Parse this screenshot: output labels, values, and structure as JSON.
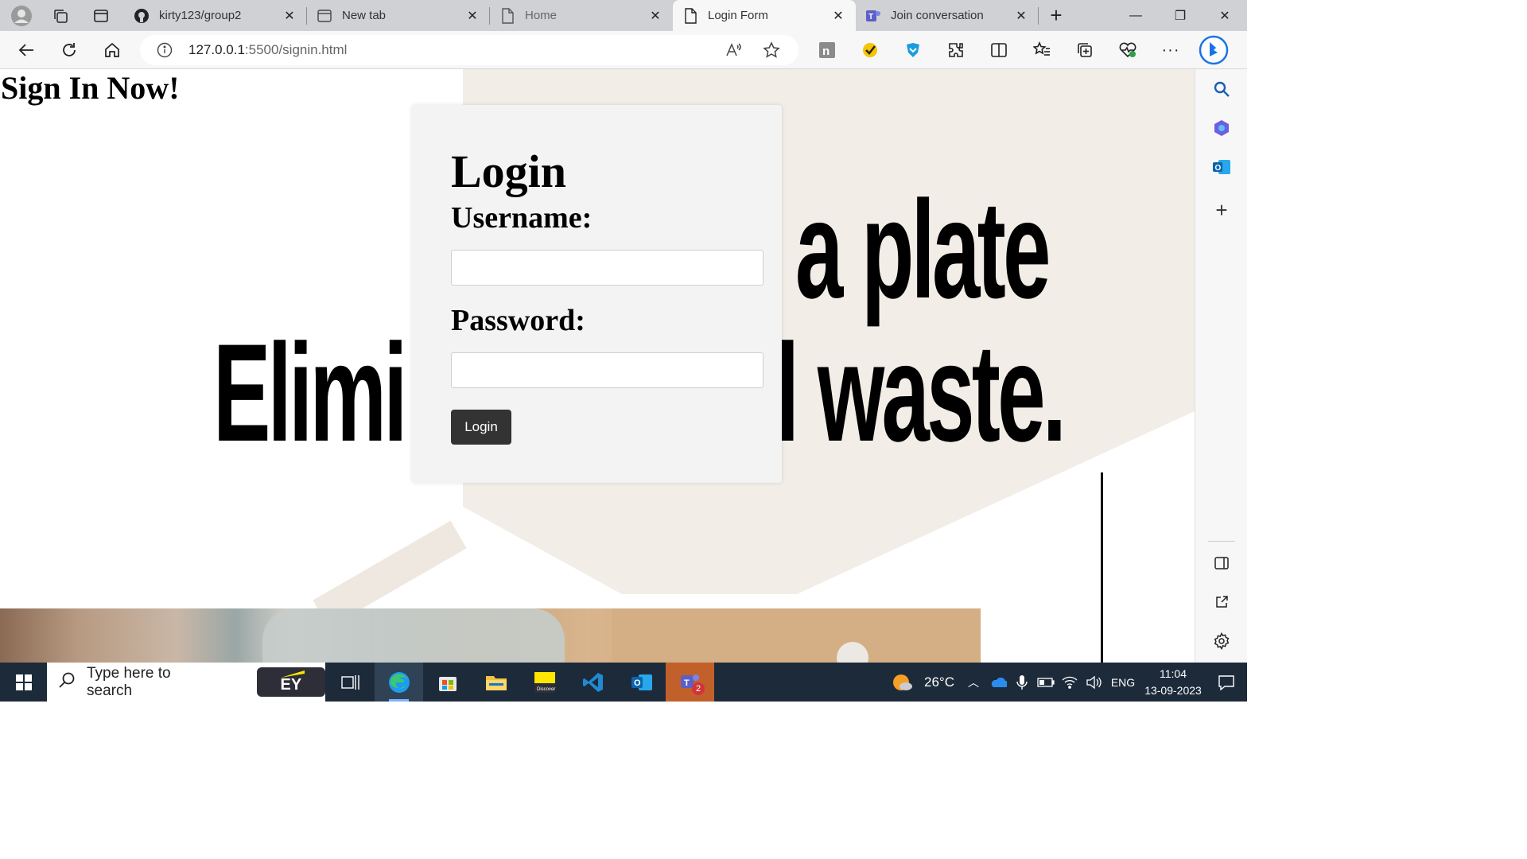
{
  "browser": {
    "tabs": [
      {
        "title": "kirty123/group2",
        "icon": "github-icon",
        "active": false
      },
      {
        "title": "New tab",
        "icon": "newtab-icon",
        "active": false
      },
      {
        "title": "Home",
        "icon": "page-icon",
        "active": false
      },
      {
        "title": "Login Form",
        "icon": "page-icon",
        "active": true
      },
      {
        "title": "Join conversation",
        "icon": "teams-icon",
        "active": false
      }
    ],
    "url_host": "127.0.0.1",
    "url_rest": ":5500/signin.html"
  },
  "page": {
    "heading": "Sign In Now!",
    "hero_line1": "a plate",
    "hero_line2_left": "Elimi",
    "hero_line2_right": "l waste.",
    "form": {
      "title": "Login",
      "username_label": "Username:",
      "username_value": "",
      "password_label": "Password:",
      "password_value": "",
      "submit_label": "Login"
    }
  },
  "taskbar": {
    "search_placeholder": "Type here to search",
    "ey_label": "EY",
    "weather": "26°C",
    "language": "ENG",
    "time": "11:04",
    "date": "13-09-2023",
    "teams_badge": "2"
  },
  "colors": {
    "accent": "#0078d4",
    "card_bg": "#f3f3f3",
    "button_bg": "#333333",
    "taskbar_bg": "#1d2a3a"
  }
}
